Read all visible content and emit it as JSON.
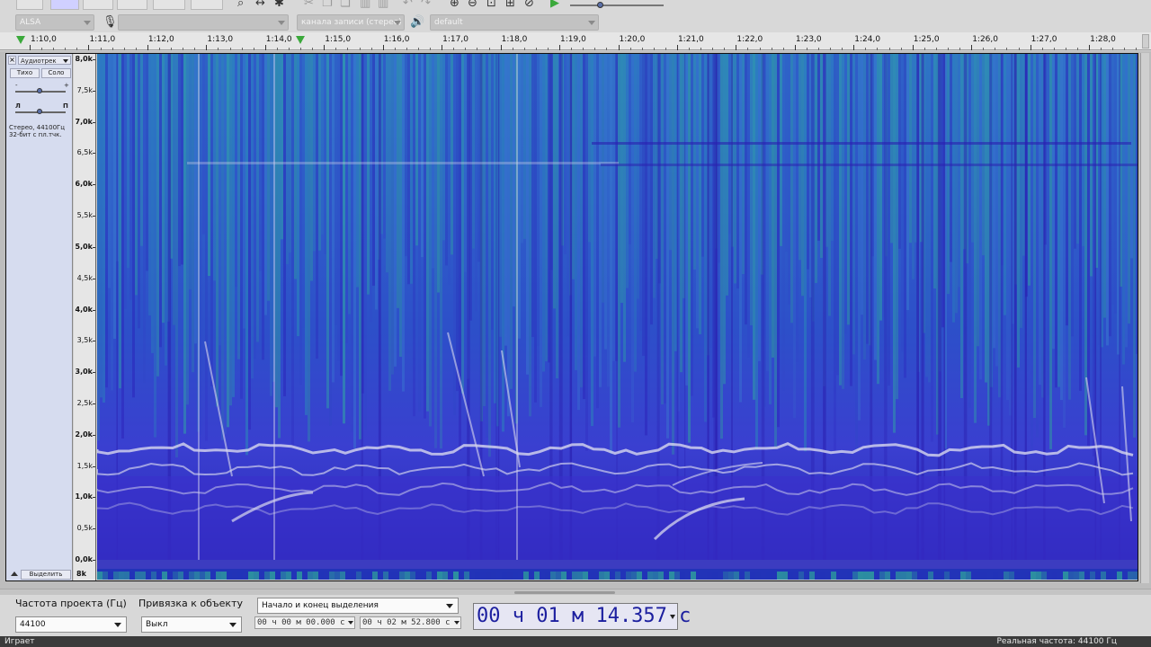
{
  "device_bar": {
    "host": "ALSA",
    "record_device": "",
    "channels": "канала записи (стерео)",
    "playback_device": "default"
  },
  "timeline": {
    "labels": [
      "1:10,0",
      "1:11,0",
      "1:12,0",
      "1:13,0",
      "1:14,0",
      "1:15,0",
      "1:16,0",
      "1:17,0",
      "1:18,0",
      "1:19,0",
      "1:20,0",
      "1:21,0",
      "1:22,0",
      "1:23,0",
      "1:24,0",
      "1:25,0",
      "1:26,0",
      "1:27,0",
      "1:28,0"
    ]
  },
  "track": {
    "name": "Аудиотрек",
    "mute_label": "Тихо",
    "solo_label": "Соло",
    "gain_minus": "-",
    "gain_plus": "+",
    "pan_left": "Л",
    "pan_right": "П",
    "info_line1": "Стерео, 44100Гц",
    "info_line2": "32-бит с пл.тчк.",
    "select_label": "Выделить",
    "strip_label": "8k"
  },
  "freq_axis": {
    "labels": [
      "8,0k",
      "7,5k",
      "7,0k",
      "6,5k",
      "6,0k",
      "5,5k",
      "5,0k",
      "4,5k",
      "4,0k",
      "3,5k",
      "3,0k",
      "2,5k",
      "2,0k",
      "1,5k",
      "1,0k",
      "0,5k",
      "0,0k"
    ]
  },
  "selection_toolbar": {
    "project_rate_label": "Частота проекта (Гц)",
    "project_rate_value": "44100",
    "snap_label": "Привязка к объекту",
    "snap_value": "Выкл",
    "selection_mode": "Начало и конец выделения",
    "sel_start": "00 ч 00 м 00.000 с",
    "sel_end": "00 ч 02 м 52.800 с",
    "audio_position": "00 ч 01 м 14.357 с"
  },
  "status": {
    "state": "Играет",
    "actual_rate": "Реальная частота: 44100 Гц"
  },
  "colors": {
    "spectrogram_low": "#2a1fb8",
    "spectrogram_high": "#2fa89a",
    "harmonic": "#d8d8ee",
    "play_marker": "#3ba93b",
    "time_digits": "#1c1f9f"
  }
}
